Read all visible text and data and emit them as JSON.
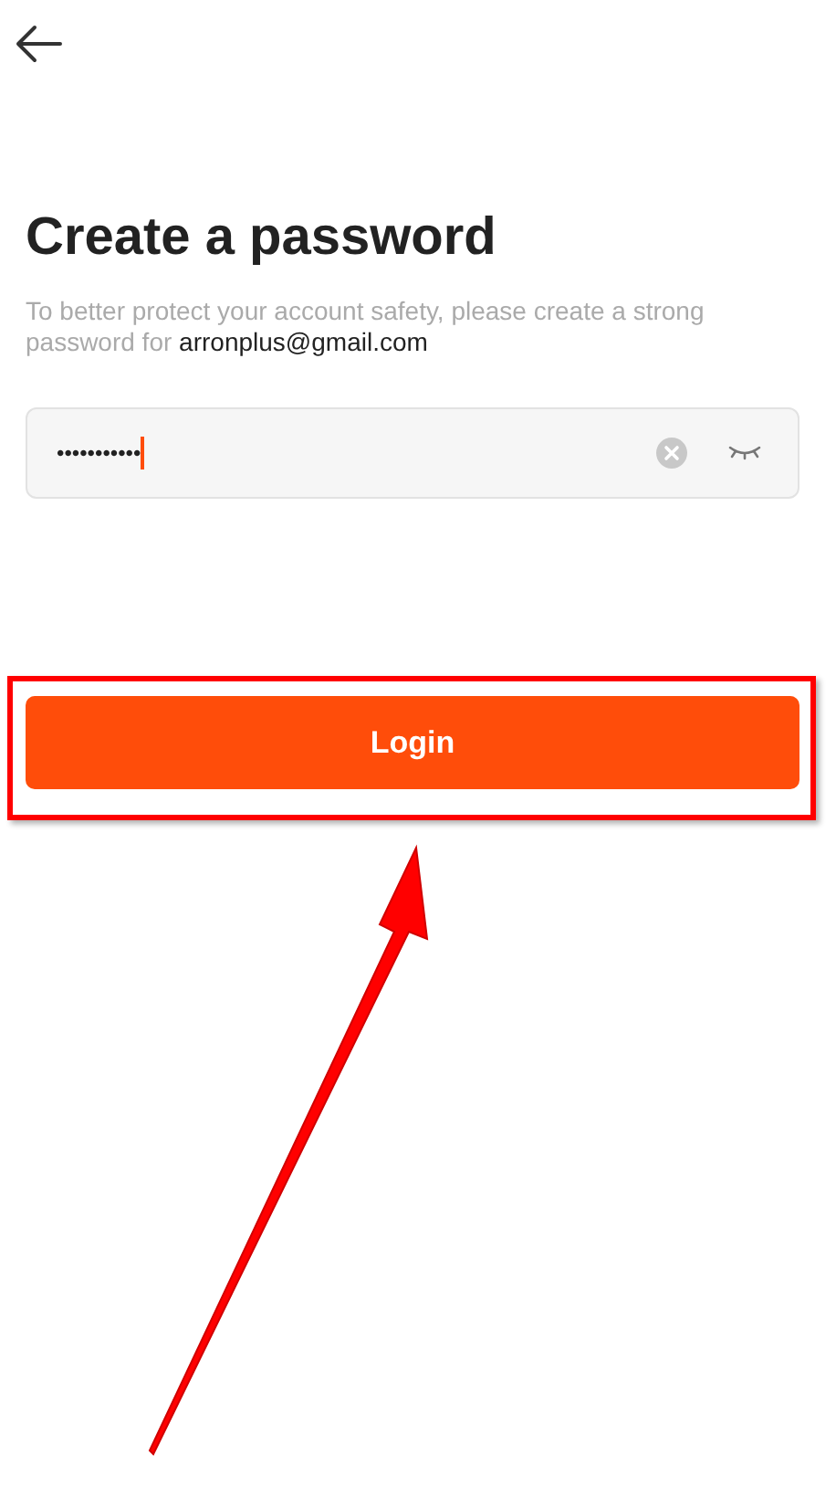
{
  "title": "Create a password",
  "description": {
    "text": "To better protect your account safety, please create a strong password for ",
    "email": "arronplus@gmail.com"
  },
  "password_field": {
    "value": "•••••••••••"
  },
  "login_button": {
    "label": "Login"
  }
}
